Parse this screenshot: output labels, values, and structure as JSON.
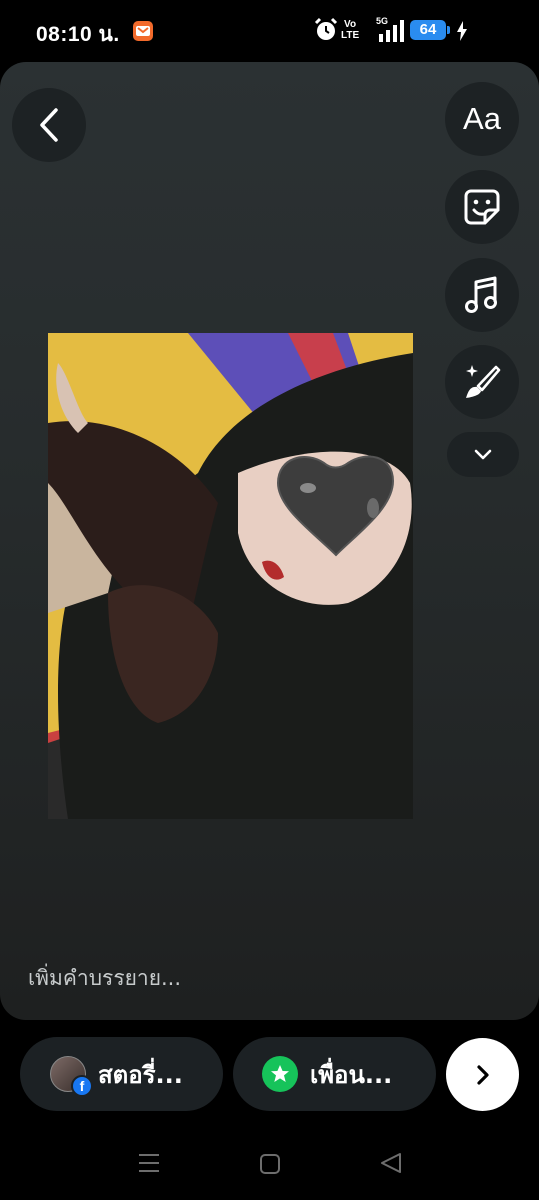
{
  "status_bar": {
    "time": "08:10 น.",
    "network_line1": "Vo",
    "network_line2": "LTE",
    "network_type": "5G",
    "battery": "64",
    "icons": [
      "app-notification-icon",
      "alarm-icon",
      "signal-icon",
      "charging-icon"
    ]
  },
  "editor": {
    "back_icon": "chevron-left-icon",
    "tools": [
      {
        "name": "text",
        "label": "Aa"
      },
      {
        "name": "sticker",
        "icon": "sticker-icon"
      },
      {
        "name": "music",
        "icon": "music-note-icon"
      },
      {
        "name": "effects",
        "icon": "magic-brush-icon"
      },
      {
        "name": "more",
        "icon": "chevron-down-icon"
      }
    ],
    "photo_description_sticker": "heart-sticker",
    "caption_placeholder": "เพิ่มคำบรรยาย..."
  },
  "share": {
    "story_label": "สตอรี่...",
    "friends_label": "เพื่อน...",
    "next_icon": "chevron-right-icon",
    "friends_color": "#16c35a",
    "facebook_color": "#1877f2"
  },
  "nav": {
    "icons": [
      "recent-apps-icon",
      "home-icon",
      "back-icon"
    ]
  }
}
